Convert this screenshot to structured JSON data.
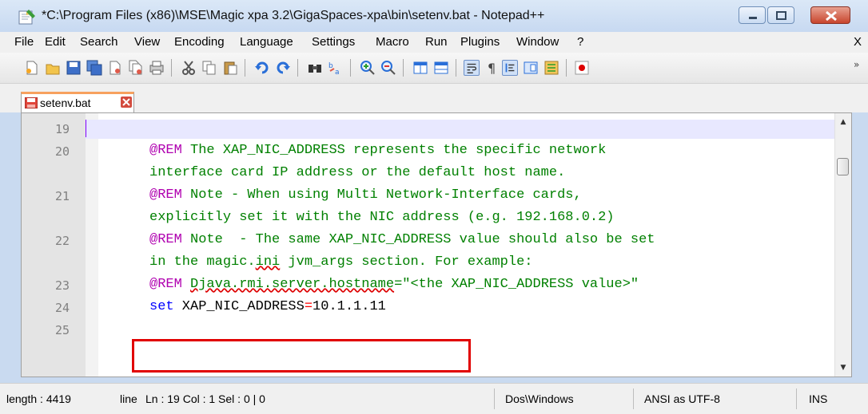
{
  "window": {
    "title": "*C:\\Program Files (x86)\\MSE\\Magic xpa 3.2\\GigaSpaces-xpa\\bin\\setenv.bat - Notepad++"
  },
  "menu": {
    "items": [
      "File",
      "Edit",
      "Search",
      "View",
      "Encoding",
      "Language",
      "Settings",
      "Macro",
      "Run",
      "Plugins",
      "Window",
      "?"
    ],
    "close_label": "X"
  },
  "toolbar": {
    "icons": [
      "new-file-icon",
      "open-file-icon",
      "save-icon",
      "save-all-icon",
      "close-icon",
      "close-all-icon",
      "print-icon",
      "cut-icon",
      "copy-icon",
      "paste-icon",
      "undo-icon",
      "redo-icon",
      "find-icon",
      "replace-icon",
      "zoom-in-icon",
      "zoom-out-icon",
      "sync-vertical-icon",
      "sync-horizontal-icon",
      "word-wrap-icon",
      "show-all-chars-icon",
      "indent-guide-icon",
      "doc-map-icon",
      "function-list-icon",
      "record-macro-icon"
    ],
    "more_label": "»"
  },
  "tab": {
    "label": "setenv.bat"
  },
  "editor": {
    "lines": [
      {
        "num": "19",
        "parts": []
      },
      {
        "num": "20",
        "parts": [
          {
            "c": "kw",
            "t": "@REM"
          },
          {
            "c": "com",
            "t": " The XAP_NIC_ADDRESS represents the specific network"
          }
        ]
      },
      {
        "num": "",
        "parts": [
          {
            "c": "com",
            "t": "interface card IP address or the default host name."
          }
        ]
      },
      {
        "num": "21",
        "parts": [
          {
            "c": "kw",
            "t": "@REM"
          },
          {
            "c": "com",
            "t": " Note - When using Multi Network-Interface cards,"
          }
        ]
      },
      {
        "num": "",
        "parts": [
          {
            "c": "com",
            "t": "explicitly set it with the NIC address (e.g. 192.168.0.2)"
          }
        ]
      },
      {
        "num": "22",
        "parts": [
          {
            "c": "kw",
            "t": "@REM"
          },
          {
            "c": "com",
            "t": " Note  - The same XAP_NIC_ADDRESS value should also be set"
          }
        ]
      },
      {
        "num": "",
        "parts": [
          {
            "c": "com",
            "t": "in the magic."
          },
          {
            "c": "com sq",
            "t": "ini"
          },
          {
            "c": "com",
            "t": " jvm_args section. For example:"
          }
        ]
      },
      {
        "num": "23",
        "parts": [
          {
            "c": "kw",
            "t": "@REM"
          },
          {
            "c": "com",
            "t": " "
          },
          {
            "c": "com sq",
            "t": "Djava.rmi.server.hostname"
          },
          {
            "c": "com",
            "t": "=\"<the XAP_NIC_ADDRESS value>\""
          }
        ]
      },
      {
        "num": "24",
        "parts": [
          {
            "c": "set",
            "t": "set"
          },
          {
            "c": "var",
            "t": " XAP_NIC_ADDRESS"
          },
          {
            "c": "eq",
            "t": "="
          },
          {
            "c": "val",
            "t": "10.1.1.11"
          }
        ]
      },
      {
        "num": "25",
        "parts": []
      }
    ]
  },
  "status": {
    "length": "length : 4419",
    "lines": "line",
    "position": "Ln : 19    Col : 1    Sel : 0 | 0",
    "eol": "Dos\\Windows",
    "encoding": "ANSI as UTF-8",
    "mode": "INS"
  },
  "colors": {
    "comment": "#008000",
    "rem_keyword": "#b000b0",
    "set_keyword": "#0000ff",
    "operator": "#ff0000",
    "highlight_box": "#e10000"
  }
}
